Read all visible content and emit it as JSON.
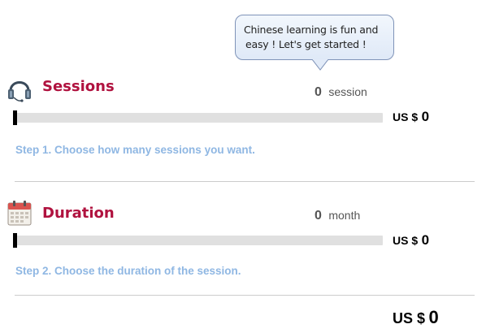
{
  "bubble": {
    "line1": "Chinese learning is fun and",
    "line2": "easy ! Let's get started !"
  },
  "sessions": {
    "title": "Sessions",
    "count": "0",
    "unit": "session",
    "price_label": "US $",
    "price": "0",
    "slider_value": 0,
    "step": "Step 1. Choose how many sessions you want."
  },
  "duration": {
    "title": "Duration",
    "count": "0",
    "unit": "month",
    "price_label": "US $",
    "price": "0",
    "slider_value": 0,
    "step": "Step 2. Choose the duration of the session."
  },
  "total": {
    "label": "US $",
    "value": "0"
  },
  "colors": {
    "title": "#b0123f",
    "step": "#8fb7e3",
    "track": "#e0e0e0"
  }
}
